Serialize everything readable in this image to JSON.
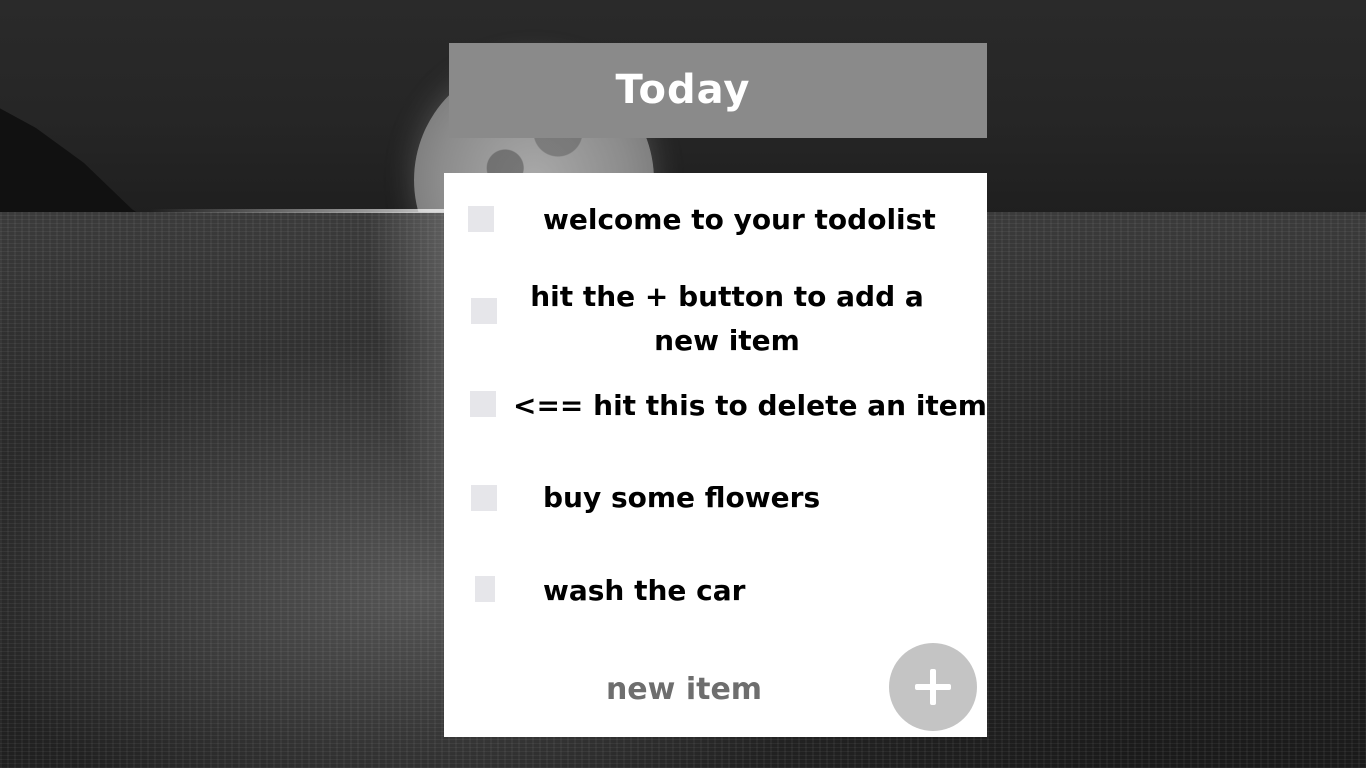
{
  "app": {
    "title": "Today"
  },
  "theme": {
    "header_bg": "#8a8a8a",
    "card_bg": "#ffffff",
    "checkbox_bg": "#e6e6ea",
    "add_button_bg": "#c4c4c4",
    "text_color": "#000000",
    "placeholder_color": "#6e6e6e",
    "background": "night sea with moon, grayscale photo"
  },
  "todo": {
    "items": [
      {
        "text": "welcome to your todolist",
        "checked": false
      },
      {
        "text": "hit the + button to add a new item",
        "checked": false
      },
      {
        "text": "<== hit this to delete an item",
        "checked": false
      },
      {
        "text": "buy some flowers",
        "checked": false
      },
      {
        "text": "wash the car",
        "checked": false
      }
    ],
    "new_item": {
      "placeholder": "new item",
      "value": ""
    },
    "add_button_icon": "plus-icon"
  }
}
